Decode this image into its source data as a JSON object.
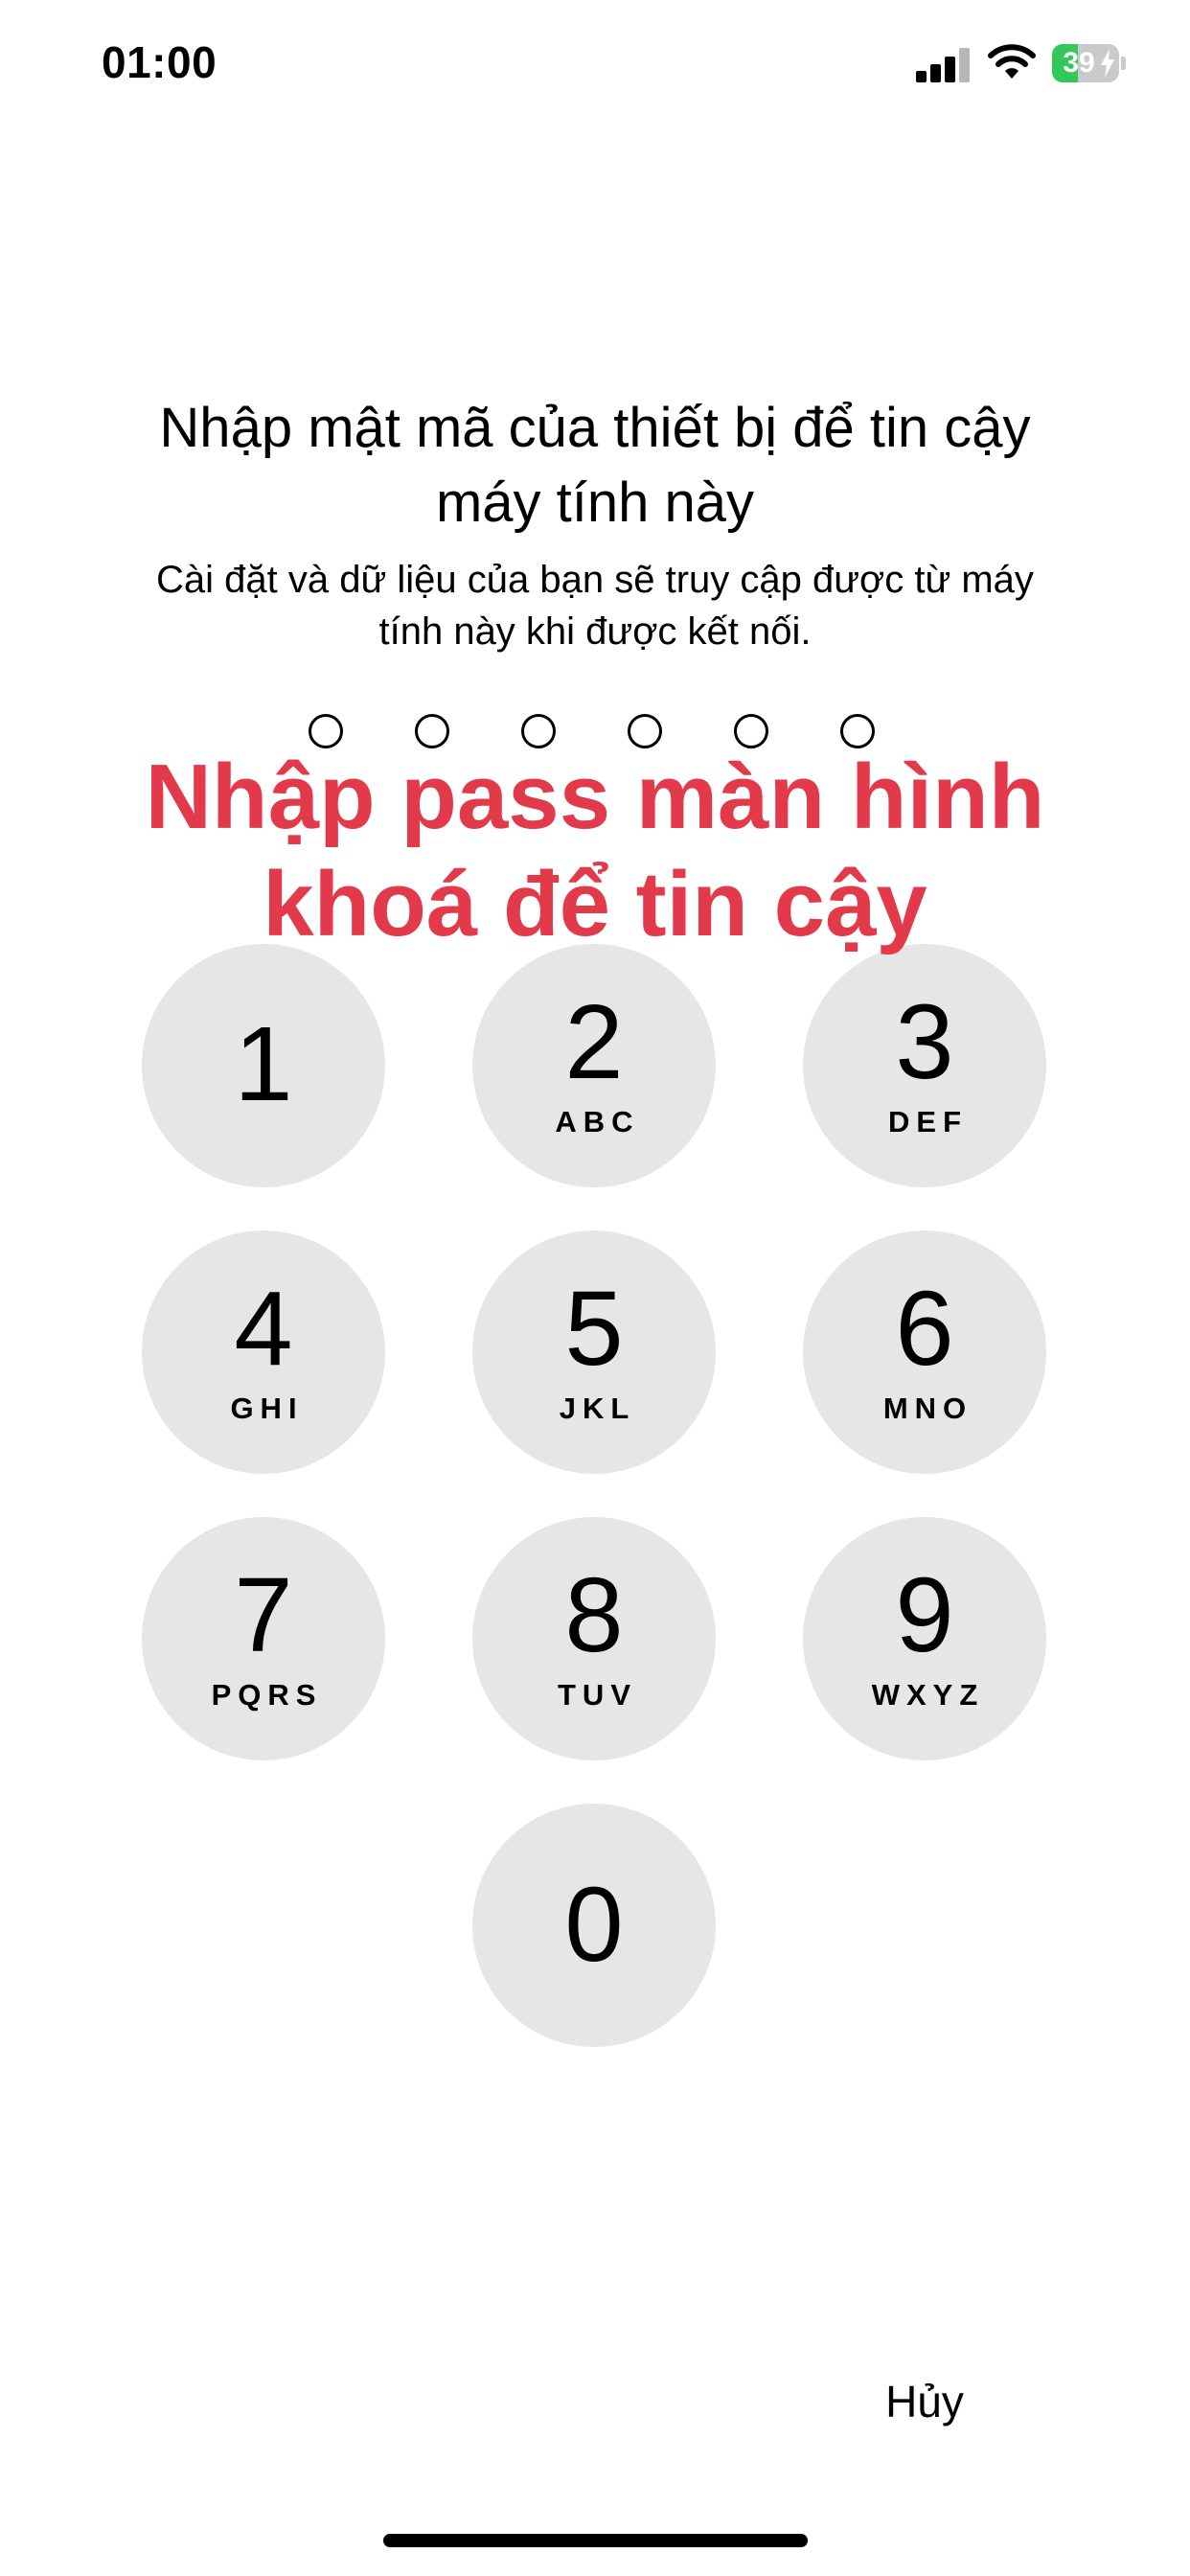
{
  "status_bar": {
    "time": "01:00",
    "battery_level": "39",
    "battery_fraction": 0.39,
    "signal_bars_active": 3,
    "signal_bars_total": 4
  },
  "prompt": {
    "title_line1": "Nhập mật mã của thiết bị để tin cậy",
    "title_line2": "máy tính này",
    "subtitle_line1": "Cài đặt và dữ liệu của bạn sẽ truy cập được từ máy",
    "subtitle_line2": "tính này khi được kết nối."
  },
  "passcode": {
    "length": 6,
    "entered": 0
  },
  "overlay": {
    "line1": "Nhập pass màn hình",
    "line2": "khoá để tin cậy",
    "color": "#e23a4a"
  },
  "keypad": {
    "keys": [
      {
        "digit": "1",
        "letters": ""
      },
      {
        "digit": "2",
        "letters": "ABC"
      },
      {
        "digit": "3",
        "letters": "DEF"
      },
      {
        "digit": "4",
        "letters": "GHI"
      },
      {
        "digit": "5",
        "letters": "JKL"
      },
      {
        "digit": "6",
        "letters": "MNO"
      },
      {
        "digit": "7",
        "letters": "PQRS"
      },
      {
        "digit": "8",
        "letters": "TUV"
      },
      {
        "digit": "9",
        "letters": "WXYZ"
      },
      {
        "digit": "0",
        "letters": ""
      }
    ]
  },
  "actions": {
    "cancel_label": "Hủy"
  },
  "colors": {
    "key_background": "#e6e6e6",
    "battery_green": "#34c759",
    "text": "#000000"
  }
}
